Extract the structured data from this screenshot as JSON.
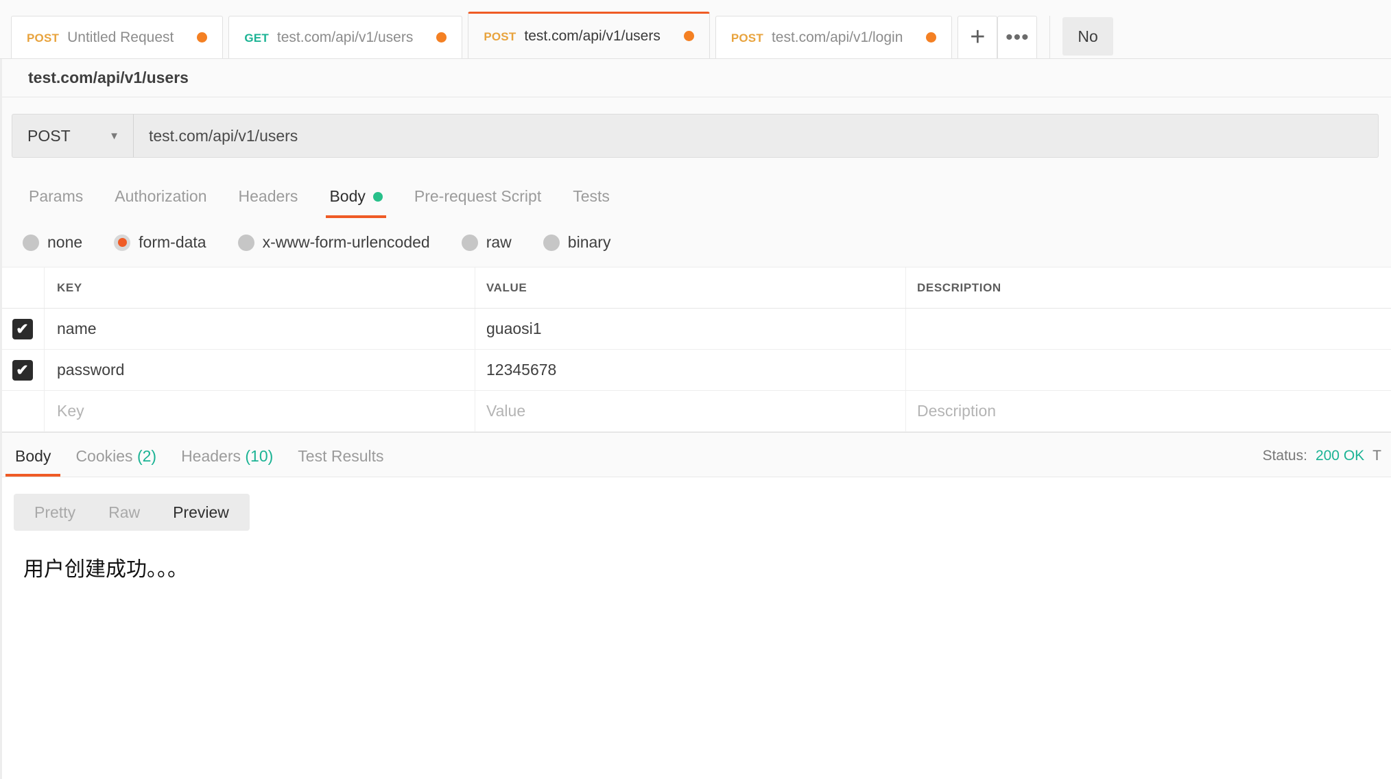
{
  "tabbar": {
    "tabs": [
      {
        "method": "POST",
        "method_class": "m-post",
        "name": "Untitled Request",
        "unsaved": true,
        "active": false
      },
      {
        "method": "GET",
        "method_class": "m-get",
        "name": "test.com/api/v1/users",
        "unsaved": true,
        "active": false
      },
      {
        "method": "POST",
        "method_class": "m-post",
        "name": "test.com/api/v1/users",
        "unsaved": true,
        "active": true
      },
      {
        "method": "POST",
        "method_class": "m-post",
        "name": "test.com/api/v1/login",
        "unsaved": true,
        "active": false
      }
    ],
    "new_tab_icon": "plus-icon",
    "more_icon": "ellipsis-icon",
    "environment_selector": "No"
  },
  "request": {
    "name": "test.com/api/v1/users",
    "method": "POST",
    "method_caret": "▼",
    "url": "test.com/api/v1/users",
    "tabs": [
      {
        "label": "Params",
        "active": false,
        "dot": false
      },
      {
        "label": "Authorization",
        "active": false,
        "dot": false
      },
      {
        "label": "Headers",
        "active": false,
        "dot": false
      },
      {
        "label": "Body",
        "active": true,
        "dot": true
      },
      {
        "label": "Pre-request Script",
        "active": false,
        "dot": false
      },
      {
        "label": "Tests",
        "active": false,
        "dot": false
      }
    ],
    "body_types": [
      {
        "label": "none",
        "selected": false
      },
      {
        "label": "form-data",
        "selected": true
      },
      {
        "label": "x-www-form-urlencoded",
        "selected": false
      },
      {
        "label": "raw",
        "selected": false
      },
      {
        "label": "binary",
        "selected": false
      }
    ],
    "table": {
      "columns": [
        "KEY",
        "VALUE",
        "DESCRIPTION"
      ],
      "rows": [
        {
          "enabled": true,
          "key": "name",
          "value": "guaosi1",
          "description": ""
        },
        {
          "enabled": true,
          "key": "password",
          "value": "12345678",
          "description": ""
        }
      ],
      "placeholders": {
        "key": "Key",
        "value": "Value",
        "description": "Description"
      }
    }
  },
  "response": {
    "tabs": [
      {
        "label": "Body",
        "count": "",
        "active": true
      },
      {
        "label": "Cookies",
        "count": "(2)",
        "active": false
      },
      {
        "label": "Headers",
        "count": "(10)",
        "active": false
      },
      {
        "label": "Test Results",
        "count": "",
        "active": false
      }
    ],
    "status_label": "Status:",
    "status_value": "200 OK",
    "time_label_partial": "T",
    "views": [
      {
        "label": "Pretty",
        "active": false
      },
      {
        "label": "Raw",
        "active": false
      },
      {
        "label": "Preview",
        "active": true
      }
    ],
    "body_text": "用户创建成功。。。"
  },
  "colors": {
    "accent": "#ef5b25",
    "unsaved_dot": "#f48023",
    "method_post": "#e8a33d",
    "method_get": "#1bb394",
    "success_green": "#1bb394",
    "body_dot_green": "#28c08a",
    "checkbox": "#2b2b2b"
  }
}
